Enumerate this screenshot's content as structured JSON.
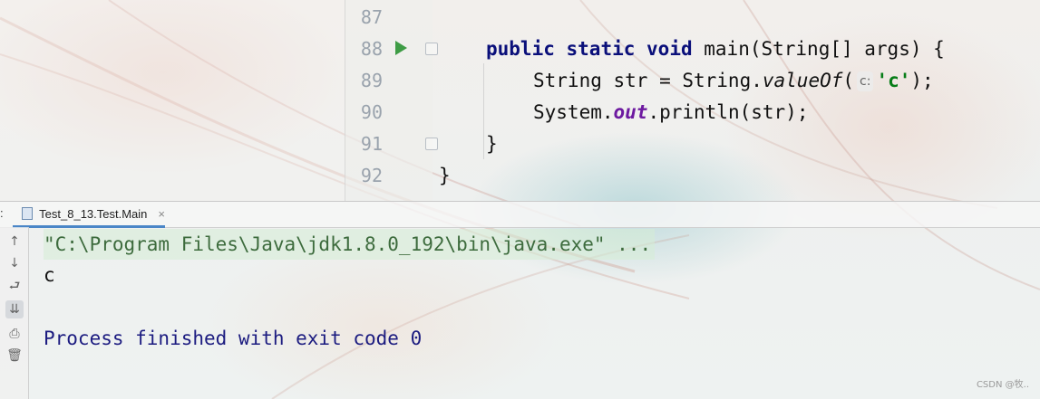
{
  "editor": {
    "line_numbers": [
      "87",
      "88",
      "89",
      "90",
      "91",
      "92"
    ],
    "code": {
      "line88": {
        "kw1": "public",
        "kw2": "static",
        "kw3": "void",
        "rest": "main(String[] args) {"
      },
      "line89": {
        "pre": "String str = String.",
        "method": "valueOf",
        "open": "(",
        "hint": "c:",
        "str": "'c'",
        "close": ");"
      },
      "line90": {
        "pre": "System.",
        "field": "out",
        "rest": ".println(str);"
      },
      "line91": {
        "text": "}"
      },
      "line92": {
        "text": "}"
      }
    }
  },
  "run_panel": {
    "tab_prefix": ":",
    "tab_label": "Test_8_13.Test.Main",
    "tab_close": "×",
    "console": {
      "command": "\"C:\\Program Files\\Java\\jdk1.8.0_192\\bin\\java.exe\" ...",
      "output": "c",
      "exit_message": "Process finished with exit code 0"
    },
    "toolbar_icons": [
      "arrow-up-icon",
      "arrow-down-icon",
      "soft-wrap-icon",
      "scroll-to-end-icon",
      "print-icon",
      "trash-icon"
    ]
  },
  "watermark": "CSDN @牧..",
  "colors": {
    "keyword": "#0a0f7a",
    "string": "#067d17",
    "field": "#6d1aa0",
    "run_green": "#3e9c45",
    "exit_text": "#1c1c80"
  }
}
